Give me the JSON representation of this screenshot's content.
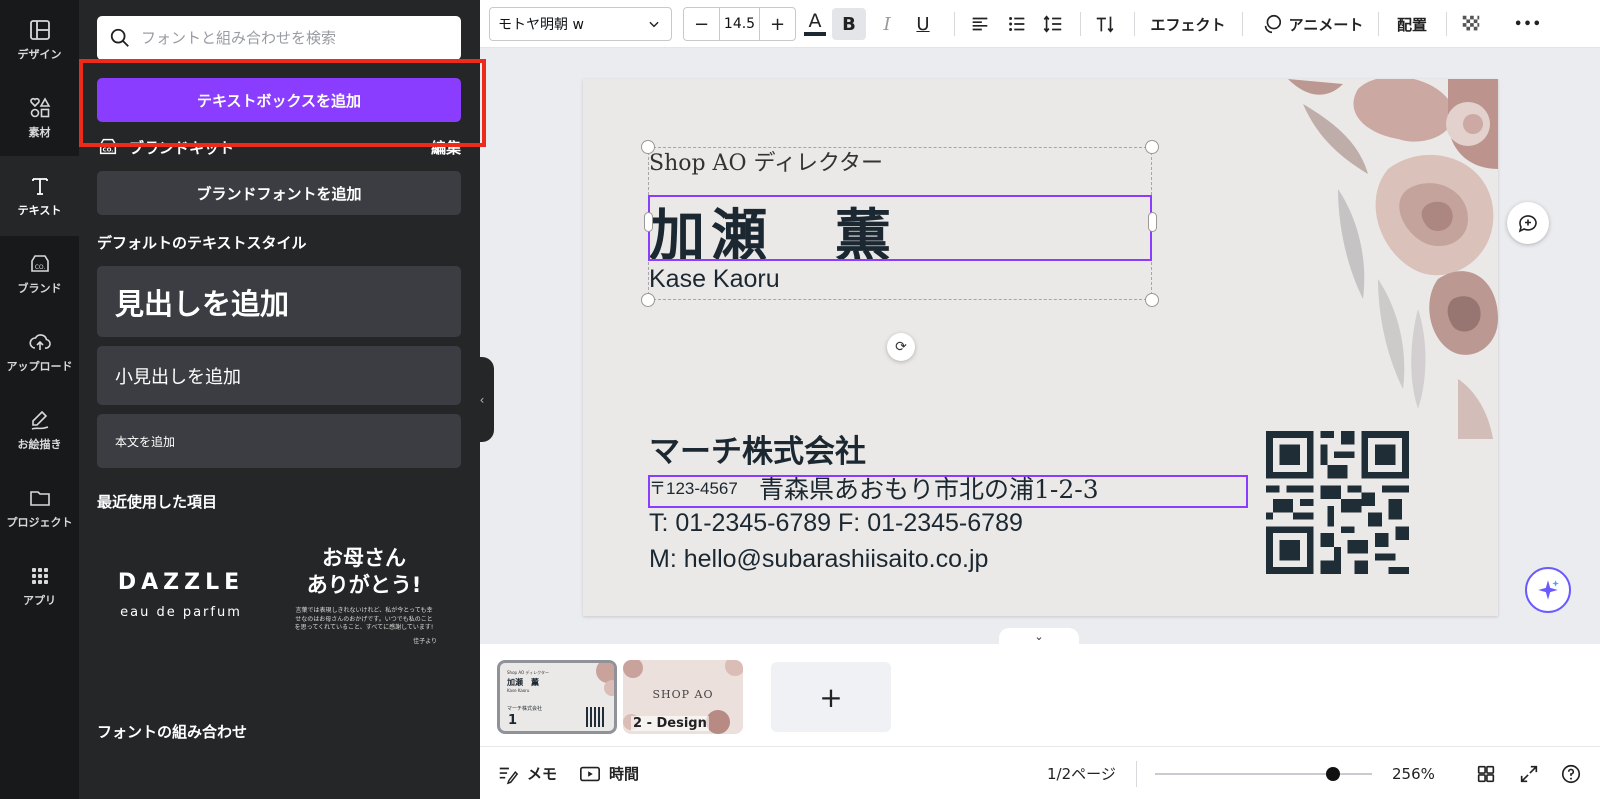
{
  "rail": {
    "items": [
      {
        "label": "デザイン",
        "icon": "layout-icon"
      },
      {
        "label": "素材",
        "icon": "elements-icon"
      },
      {
        "label": "テキスト",
        "icon": "text-icon"
      },
      {
        "label": "ブランド",
        "icon": "brand-icon"
      },
      {
        "label": "アップロード",
        "icon": "upload-icon"
      },
      {
        "label": "お絵描き",
        "icon": "draw-icon"
      },
      {
        "label": "プロジェクト",
        "icon": "folder-icon"
      },
      {
        "label": "アプリ",
        "icon": "apps-icon"
      }
    ]
  },
  "panel": {
    "search_placeholder": "フォントと組み合わせを検索",
    "add_textbox": "テキストボックスを追加",
    "brand_kit": "ブランドキット",
    "brand_edit": "編集",
    "add_brand_font": "ブランドフォントを追加",
    "default_styles_title": "デフォルトのテキストスタイル",
    "heading": "見出しを追加",
    "subheading": "小見出しを追加",
    "body": "本文を追加",
    "recent_title": "最近使用した項目",
    "recent1_line1": "DAZZLE",
    "recent1_line2": "eau de parfum",
    "recent2_line1": "お母さん",
    "recent2_line2": "ありがとう!",
    "recent2_small": "言葉では表現しきれないけれど、私が今とっても幸せなのはお母さんのおかげです。いつでも私のことを思ってくれていること、すべてに感謝しています!",
    "recent2_sig": "佳子より",
    "font_combos_title": "フォントの組み合わせ"
  },
  "toolbar": {
    "font": "モトヤ明朝 w",
    "size": "14.5",
    "minus": "−",
    "plus": "+",
    "text_color_glyph": "A",
    "bold": "B",
    "italic": "I",
    "underline": "U",
    "effects": "エフェクト",
    "animate": "アニメート",
    "position": "配置",
    "more": "•••",
    "text_color": "#1c2831"
  },
  "card": {
    "role": "Shop AO ディレクター",
    "name": "加瀬　薫",
    "romaji": "Kase Kaoru",
    "company": "マーチ株式会社",
    "zip": "〒123-4567",
    "address": "青森県あおもり市北の浦1-2-3",
    "phone": "T: 01-2345-6789   F: 01-2345-6789",
    "mail": "M: hello@subarashiisaito.co.jp"
  },
  "pages": {
    "p1_num": "1",
    "p1_role": "Shop AO ディレクター",
    "p1_name": "加瀬　薫",
    "p1_romaji": "Kase Kaoru",
    "p1_company": "マーチ株式会社",
    "p2_label": "2 - Design",
    "p2_title": "SHOP AO",
    "add": "+"
  },
  "bottombar": {
    "notes": "メモ",
    "time": "時間",
    "page_count": "1/2ページ",
    "zoom": "256%",
    "zoom_level": 0.82
  },
  "colors": {
    "accent": "#8b3dff",
    "highlight": "#ee2b1b",
    "panel_bg": "#252627",
    "rail_bg": "#18191b",
    "card_bg": "#ebe9e7"
  }
}
